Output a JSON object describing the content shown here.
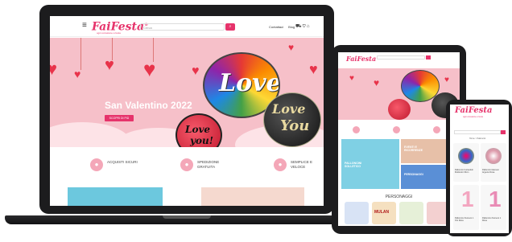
{
  "laptop": {
    "menu_icon": "≡",
    "logo": "FaiFesta",
    "logo_mark": "®",
    "tagline": "ogni occasione è festa",
    "search_placeholder": "Cerca",
    "search_icon": "search-icon",
    "links": [
      "Contattaci",
      "Blog"
    ],
    "icons_glyph": "⛟♡⌂",
    "hero_title": "San Valentino 2022",
    "hero_button": "SCOPRI DI PIÙ",
    "balloon_love": "Love",
    "balloon_love_you_1": "Love",
    "balloon_love_you_2": "You",
    "balloon_red_1": "Love",
    "balloon_red_2": "you!",
    "features": [
      {
        "icon": "lock-icon",
        "glyph": "🔒",
        "text": "ACQUISTI SICURI"
      },
      {
        "icon": "cart-icon",
        "glyph": "🛒",
        "text": "SPEDIZIONE GRATUITA"
      },
      {
        "icon": "location-icon",
        "glyph": "⬤",
        "text": "SEMPLICE E VELOCE"
      }
    ]
  },
  "tablet": {
    "logo": "FaiFesta",
    "tile_1": "PALLONCINI SOLLETICO",
    "tile_2": "EVENTI E RICORRENZE",
    "tile_3": "PERSONAGGI",
    "section_title": "PERSONAGGI",
    "character_1": "MULAN",
    "colors": {
      "brand": "#e6336b"
    }
  },
  "phone": {
    "logo": "FaiFesta",
    "tagline": "ogni occasione è festa",
    "breadcrumb": "Home > Palloncini",
    "products": [
      {
        "name": "Palloncini Coriandoli Multicolor 30cm"
      },
      {
        "name": "Palloncini Glamour Argento Rosa"
      },
      {
        "name": "Palloncino Numero 1 Oro Rosa"
      },
      {
        "name": "Palloncino Numero 1 Rosa"
      }
    ]
  }
}
